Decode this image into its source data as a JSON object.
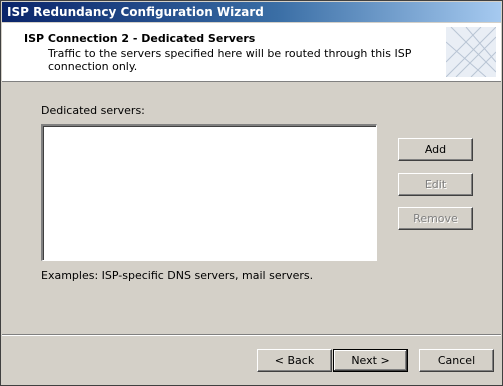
{
  "window": {
    "title": "ISP Redundancy Configuration Wizard"
  },
  "header": {
    "title": "ISP Connection 2 - Dedicated Servers",
    "subtitle": "Traffic to the servers specified here will be routed through this ISP connection only."
  },
  "main": {
    "list_label": "Dedicated servers:",
    "list_items": [],
    "examples_text": "Examples: ISP-specific DNS servers, mail servers."
  },
  "side_buttons": {
    "add": "Add",
    "edit": "Edit",
    "remove": "Remove"
  },
  "footer": {
    "back": "< Back",
    "next": "Next >",
    "cancel": "Cancel"
  }
}
